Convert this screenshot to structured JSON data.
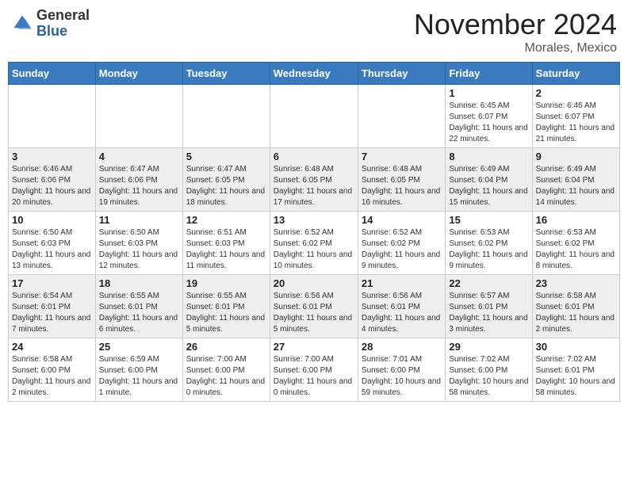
{
  "logo": {
    "general": "General",
    "blue": "Blue"
  },
  "title": "November 2024",
  "location": "Morales, Mexico",
  "days_of_week": [
    "Sunday",
    "Monday",
    "Tuesday",
    "Wednesday",
    "Thursday",
    "Friday",
    "Saturday"
  ],
  "weeks": [
    [
      {
        "num": "",
        "sunrise": "",
        "sunset": "",
        "daylight": ""
      },
      {
        "num": "",
        "sunrise": "",
        "sunset": "",
        "daylight": ""
      },
      {
        "num": "",
        "sunrise": "",
        "sunset": "",
        "daylight": ""
      },
      {
        "num": "",
        "sunrise": "",
        "sunset": "",
        "daylight": ""
      },
      {
        "num": "",
        "sunrise": "",
        "sunset": "",
        "daylight": ""
      },
      {
        "num": "1",
        "sunrise": "Sunrise: 6:45 AM",
        "sunset": "Sunset: 6:07 PM",
        "daylight": "Daylight: 11 hours and 22 minutes."
      },
      {
        "num": "2",
        "sunrise": "Sunrise: 6:46 AM",
        "sunset": "Sunset: 6:07 PM",
        "daylight": "Daylight: 11 hours and 21 minutes."
      }
    ],
    [
      {
        "num": "3",
        "sunrise": "Sunrise: 6:46 AM",
        "sunset": "Sunset: 6:06 PM",
        "daylight": "Daylight: 11 hours and 20 minutes."
      },
      {
        "num": "4",
        "sunrise": "Sunrise: 6:47 AM",
        "sunset": "Sunset: 6:06 PM",
        "daylight": "Daylight: 11 hours and 19 minutes."
      },
      {
        "num": "5",
        "sunrise": "Sunrise: 6:47 AM",
        "sunset": "Sunset: 6:05 PM",
        "daylight": "Daylight: 11 hours and 18 minutes."
      },
      {
        "num": "6",
        "sunrise": "Sunrise: 6:48 AM",
        "sunset": "Sunset: 6:05 PM",
        "daylight": "Daylight: 11 hours and 17 minutes."
      },
      {
        "num": "7",
        "sunrise": "Sunrise: 6:48 AM",
        "sunset": "Sunset: 6:05 PM",
        "daylight": "Daylight: 11 hours and 16 minutes."
      },
      {
        "num": "8",
        "sunrise": "Sunrise: 6:49 AM",
        "sunset": "Sunset: 6:04 PM",
        "daylight": "Daylight: 11 hours and 15 minutes."
      },
      {
        "num": "9",
        "sunrise": "Sunrise: 6:49 AM",
        "sunset": "Sunset: 6:04 PM",
        "daylight": "Daylight: 11 hours and 14 minutes."
      }
    ],
    [
      {
        "num": "10",
        "sunrise": "Sunrise: 6:50 AM",
        "sunset": "Sunset: 6:03 PM",
        "daylight": "Daylight: 11 hours and 13 minutes."
      },
      {
        "num": "11",
        "sunrise": "Sunrise: 6:50 AM",
        "sunset": "Sunset: 6:03 PM",
        "daylight": "Daylight: 11 hours and 12 minutes."
      },
      {
        "num": "12",
        "sunrise": "Sunrise: 6:51 AM",
        "sunset": "Sunset: 6:03 PM",
        "daylight": "Daylight: 11 hours and 11 minutes."
      },
      {
        "num": "13",
        "sunrise": "Sunrise: 6:52 AM",
        "sunset": "Sunset: 6:02 PM",
        "daylight": "Daylight: 11 hours and 10 minutes."
      },
      {
        "num": "14",
        "sunrise": "Sunrise: 6:52 AM",
        "sunset": "Sunset: 6:02 PM",
        "daylight": "Daylight: 11 hours and 9 minutes."
      },
      {
        "num": "15",
        "sunrise": "Sunrise: 6:53 AM",
        "sunset": "Sunset: 6:02 PM",
        "daylight": "Daylight: 11 hours and 9 minutes."
      },
      {
        "num": "16",
        "sunrise": "Sunrise: 6:53 AM",
        "sunset": "Sunset: 6:02 PM",
        "daylight": "Daylight: 11 hours and 8 minutes."
      }
    ],
    [
      {
        "num": "17",
        "sunrise": "Sunrise: 6:54 AM",
        "sunset": "Sunset: 6:01 PM",
        "daylight": "Daylight: 11 hours and 7 minutes."
      },
      {
        "num": "18",
        "sunrise": "Sunrise: 6:55 AM",
        "sunset": "Sunset: 6:01 PM",
        "daylight": "Daylight: 11 hours and 6 minutes."
      },
      {
        "num": "19",
        "sunrise": "Sunrise: 6:55 AM",
        "sunset": "Sunset: 6:01 PM",
        "daylight": "Daylight: 11 hours and 5 minutes."
      },
      {
        "num": "20",
        "sunrise": "Sunrise: 6:56 AM",
        "sunset": "Sunset: 6:01 PM",
        "daylight": "Daylight: 11 hours and 5 minutes."
      },
      {
        "num": "21",
        "sunrise": "Sunrise: 6:56 AM",
        "sunset": "Sunset: 6:01 PM",
        "daylight": "Daylight: 11 hours and 4 minutes."
      },
      {
        "num": "22",
        "sunrise": "Sunrise: 6:57 AM",
        "sunset": "Sunset: 6:01 PM",
        "daylight": "Daylight: 11 hours and 3 minutes."
      },
      {
        "num": "23",
        "sunrise": "Sunrise: 6:58 AM",
        "sunset": "Sunset: 6:01 PM",
        "daylight": "Daylight: 11 hours and 2 minutes."
      }
    ],
    [
      {
        "num": "24",
        "sunrise": "Sunrise: 6:58 AM",
        "sunset": "Sunset: 6:00 PM",
        "daylight": "Daylight: 11 hours and 2 minutes."
      },
      {
        "num": "25",
        "sunrise": "Sunrise: 6:59 AM",
        "sunset": "Sunset: 6:00 PM",
        "daylight": "Daylight: 11 hours and 1 minute."
      },
      {
        "num": "26",
        "sunrise": "Sunrise: 7:00 AM",
        "sunset": "Sunset: 6:00 PM",
        "daylight": "Daylight: 11 hours and 0 minutes."
      },
      {
        "num": "27",
        "sunrise": "Sunrise: 7:00 AM",
        "sunset": "Sunset: 6:00 PM",
        "daylight": "Daylight: 11 hours and 0 minutes."
      },
      {
        "num": "28",
        "sunrise": "Sunrise: 7:01 AM",
        "sunset": "Sunset: 6:00 PM",
        "daylight": "Daylight: 10 hours and 59 minutes."
      },
      {
        "num": "29",
        "sunrise": "Sunrise: 7:02 AM",
        "sunset": "Sunset: 6:00 PM",
        "daylight": "Daylight: 10 hours and 58 minutes."
      },
      {
        "num": "30",
        "sunrise": "Sunrise: 7:02 AM",
        "sunset": "Sunset: 6:01 PM",
        "daylight": "Daylight: 10 hours and 58 minutes."
      }
    ]
  ]
}
